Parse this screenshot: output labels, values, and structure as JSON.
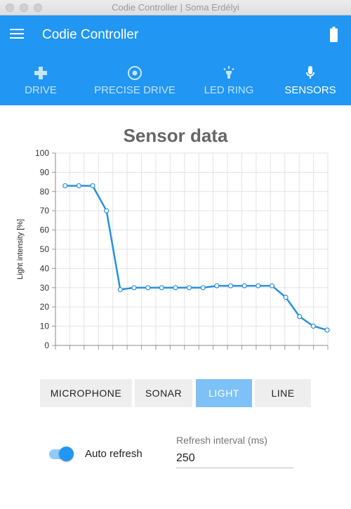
{
  "window": {
    "title": "Codie Controller | Soma Erdélyi"
  },
  "appbar": {
    "title": "Codie Controller",
    "color": "#2196f3",
    "menu_icon": "hamburger-menu-icon",
    "battery_icon": "battery-full-icon"
  },
  "tabs": [
    {
      "label": "DRIVE",
      "icon": "gamepad-icon",
      "active": false
    },
    {
      "label": "PRECISE DRIVE",
      "icon": "target-icon",
      "active": false
    },
    {
      "label": "LED RING",
      "icon": "lightbulb-icon",
      "active": false
    },
    {
      "label": "SENSORS",
      "icon": "microphone-icon",
      "active": true
    }
  ],
  "chart_data": {
    "type": "line",
    "title": "Sensor data",
    "ylabel": "Light intensity [%]",
    "xlabel": "",
    "ylim": [
      0,
      100
    ],
    "yticks": [
      0,
      10,
      20,
      30,
      40,
      50,
      60,
      70,
      80,
      90,
      100
    ],
    "x": [
      0,
      1,
      2,
      3,
      4,
      5,
      6,
      7,
      8,
      9,
      10,
      11,
      12,
      13,
      14,
      15,
      16,
      17,
      18
    ],
    "xlim": [
      -0.25,
      18.3
    ],
    "grid": true,
    "series": [
      {
        "color": "#2a8fdc",
        "values": [
          83,
          83,
          83,
          70,
          29,
          30,
          30,
          30,
          30,
          30,
          30,
          31,
          31,
          31,
          31,
          31,
          25,
          15,
          10,
          8
        ]
      }
    ]
  },
  "sensor_buttons": [
    {
      "label": "MICROPHONE",
      "active": false
    },
    {
      "label": "SONAR",
      "active": false
    },
    {
      "label": "LIGHT",
      "active": true
    },
    {
      "label": "LINE",
      "active": false
    }
  ],
  "auto_refresh": {
    "label": "Auto refresh",
    "enabled": true
  },
  "refresh_interval": {
    "label": "Refresh interval (ms)",
    "value": "250"
  }
}
